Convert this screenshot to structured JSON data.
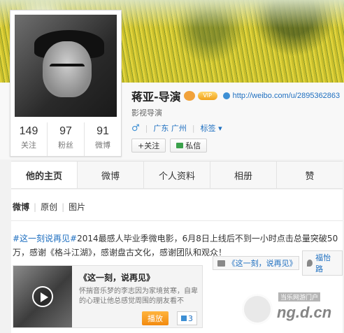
{
  "profile": {
    "name": "蒋亚-导演",
    "url": "http://weibo.com/u/2895362863",
    "intro": "影视导演",
    "vip_label": "VIP",
    "location": "广东 广州",
    "tag_label": "标签",
    "follow_label": "+关注",
    "message_label": "私信",
    "stats": [
      {
        "num": "149",
        "label": "关注"
      },
      {
        "num": "97",
        "label": "粉丝"
      },
      {
        "num": "91",
        "label": "微博"
      }
    ]
  },
  "tabs": [
    "他的主页",
    "微博",
    "个人资料",
    "相册",
    "赞"
  ],
  "subtabs": [
    "微博",
    "原创",
    "图片"
  ],
  "post": {
    "hashtag": "#这一刻说再见#",
    "text": "2014最感人毕业季微电影，6月8日上线后不到一小时点击总量突破50万，感谢《格斗江湖》，感谢盘古文化，感谢团队和观众！",
    "video_link": "《这一刻，说再见》",
    "location_link": "福怡路"
  },
  "card": {
    "title": "《这一刻，说再见》",
    "desc": "怀揣音乐梦的李志因为家境贫寒，自卑的心理让他总感觉周围的朋友看不",
    "play_label": "播放",
    "like_count": "3"
  },
  "watermark": {
    "line1": "当乐网游门户",
    "line2": "ng.d.cn"
  }
}
